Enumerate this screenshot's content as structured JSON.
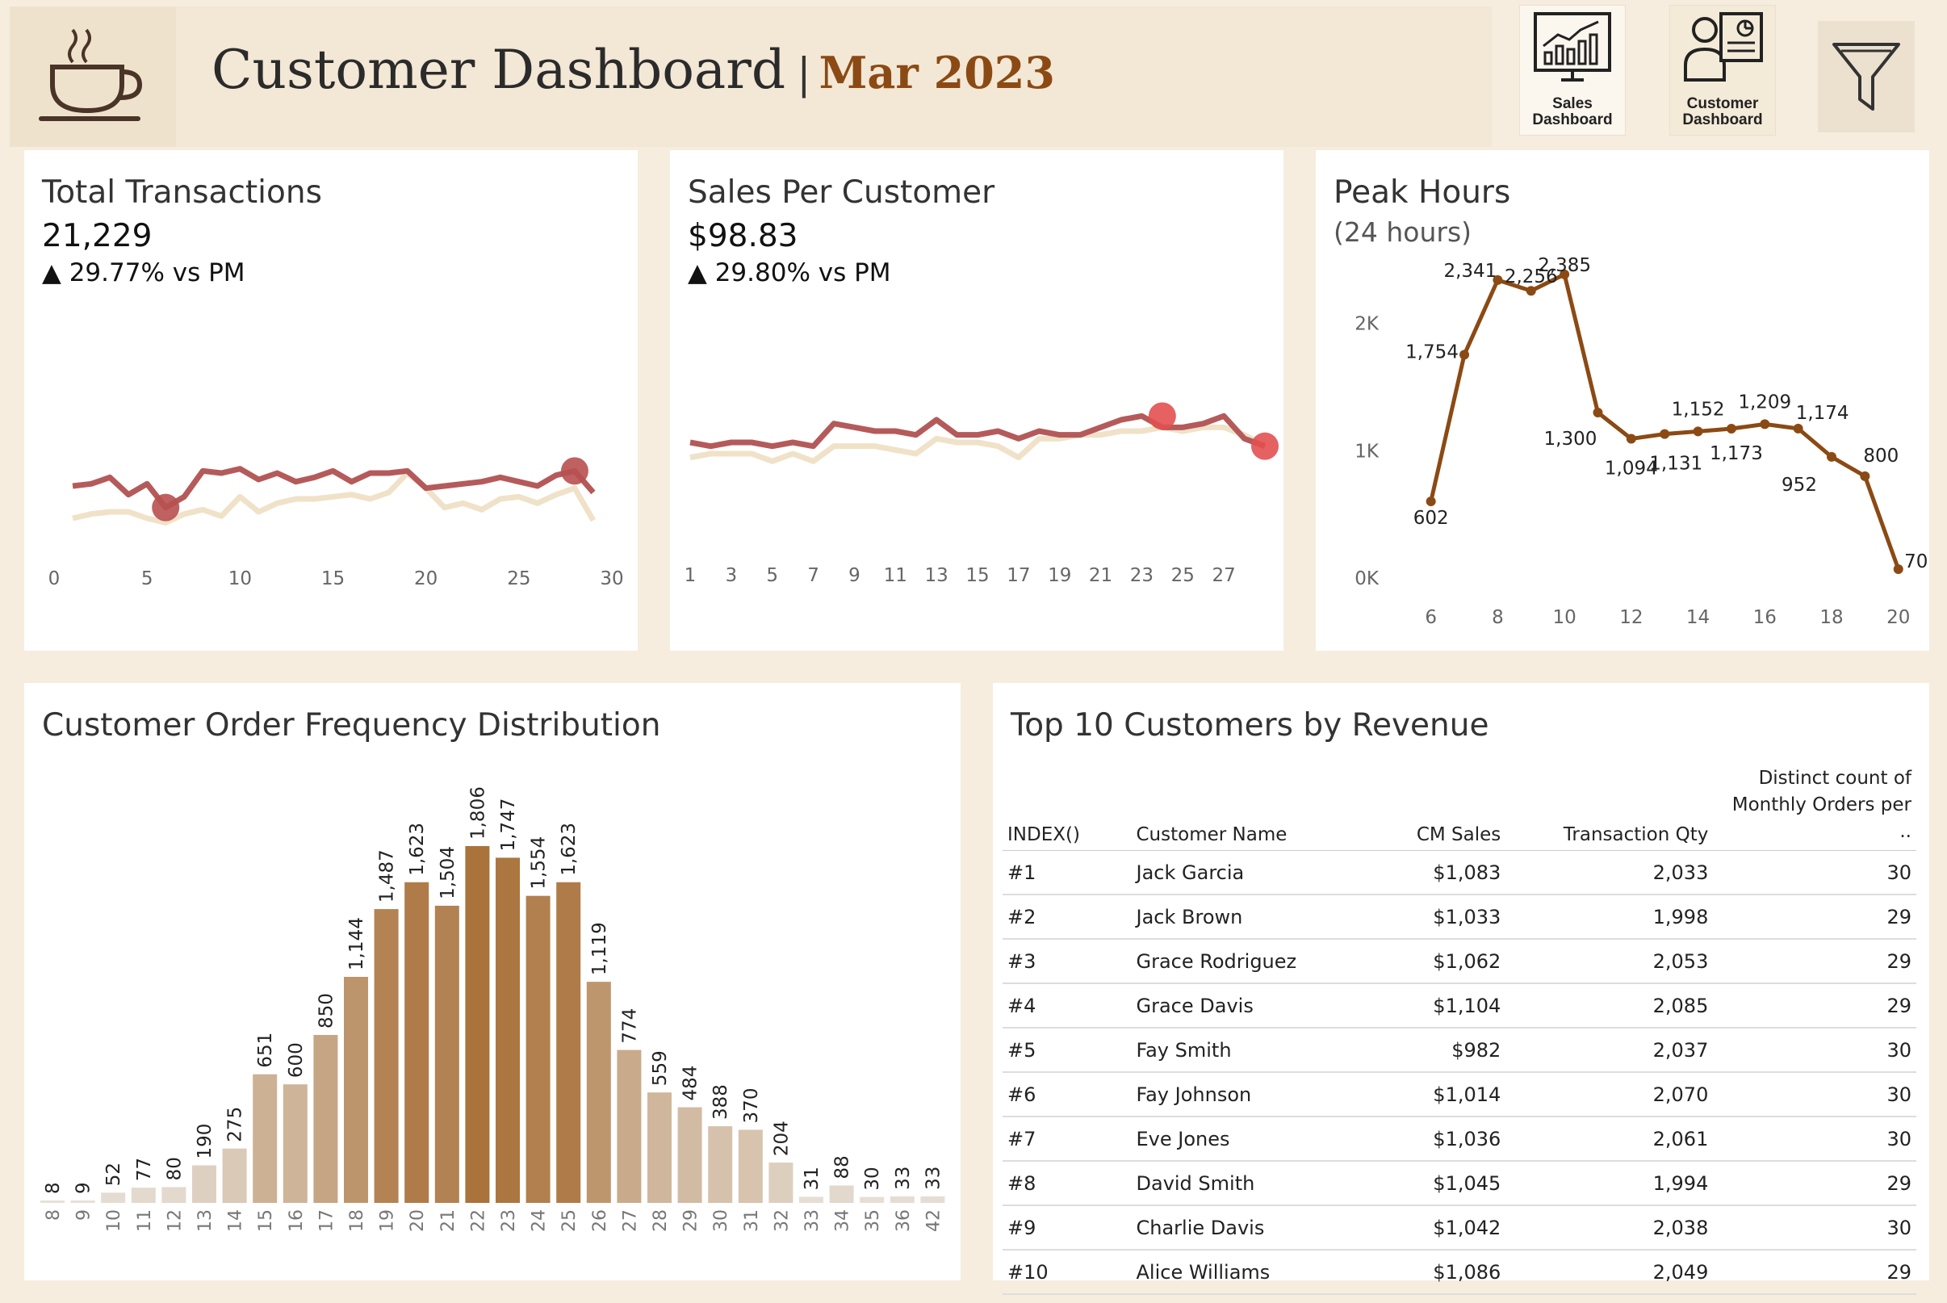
{
  "header": {
    "title": "Customer Dashboard",
    "separator": "|",
    "month": "Mar 2023",
    "nav": [
      {
        "label_line1": "Sales",
        "label_line2": "Dashboard",
        "icon": "sales-chart-icon"
      },
      {
        "label_line1": "Customer",
        "label_line2": "Dashboard",
        "icon": "customer-profile-icon"
      }
    ],
    "filter_icon": "funnel-icon",
    "logo_icon": "coffee-cup-icon"
  },
  "colors": {
    "accent": "#8b4a14",
    "current_line": "#b55a5a",
    "prior_line": "#f0e2c8",
    "peak_line": "#8b4a14",
    "highlight_dot": "#e35050"
  },
  "kpis": {
    "transactions": {
      "title": "Total Transactions",
      "value": "21,229",
      "delta": "▲ 29.77% vs PM"
    },
    "sales_per_customer": {
      "title": "Sales Per Customer",
      "value": "$98.83",
      "delta": "▲ 29.80% vs PM"
    }
  },
  "peak": {
    "title": "Peak Hours",
    "subtitle": "(24 hours)"
  },
  "distribution": {
    "title": "Customer Order Frequency Distribution"
  },
  "top10": {
    "title": "Top 10 Customers by Revenue",
    "columns": {
      "index": "INDEX()",
      "name": "Customer Name",
      "sales": "CM Sales",
      "qty": "Transaction Qty",
      "orders_line1": "Distinct count of",
      "orders_line2": "Monthly Orders per .."
    },
    "rows": [
      {
        "index": "#1",
        "name": "Jack Garcia",
        "sales": "$1,083",
        "qty": "2,033",
        "orders": "30"
      },
      {
        "index": "#2",
        "name": "Jack Brown",
        "sales": "$1,033",
        "qty": "1,998",
        "orders": "29"
      },
      {
        "index": "#3",
        "name": "Grace Rodriguez",
        "sales": "$1,062",
        "qty": "2,053",
        "orders": "29"
      },
      {
        "index": "#4",
        "name": "Grace Davis",
        "sales": "$1,104",
        "qty": "2,085",
        "orders": "29"
      },
      {
        "index": "#5",
        "name": "Fay Smith",
        "sales": "$982",
        "qty": "2,037",
        "orders": "30"
      },
      {
        "index": "#6",
        "name": "Fay Johnson",
        "sales": "$1,014",
        "qty": "2,070",
        "orders": "30"
      },
      {
        "index": "#7",
        "name": "Eve Jones",
        "sales": "$1,036",
        "qty": "2,061",
        "orders": "30"
      },
      {
        "index": "#8",
        "name": "David Smith",
        "sales": "$1,045",
        "qty": "1,994",
        "orders": "29"
      },
      {
        "index": "#9",
        "name": "Charlie Davis",
        "sales": "$1,042",
        "qty": "2,038",
        "orders": "30"
      },
      {
        "index": "#10",
        "name": "Alice Williams",
        "sales": "$1,086",
        "qty": "2,049",
        "orders": "29"
      }
    ]
  },
  "chart_data": [
    {
      "id": "transactions-trend",
      "type": "line",
      "xlabel": "",
      "ylabel": "",
      "xlim": [
        0,
        30
      ],
      "xticks": [
        "0",
        "5",
        "10",
        "15",
        "20",
        "25",
        "30"
      ],
      "ylim": [
        400,
        1000
      ],
      "series": [
        {
          "role": "current",
          "x": [
            1,
            2,
            3,
            4,
            5,
            6,
            7,
            8,
            9,
            10,
            11,
            12,
            13,
            14,
            15,
            16,
            17,
            18,
            19,
            20,
            21,
            22,
            23,
            24,
            25,
            26,
            27,
            28,
            29
          ],
          "values": [
            790,
            800,
            830,
            750,
            800,
            690,
            740,
            860,
            850,
            870,
            820,
            850,
            810,
            830,
            860,
            810,
            850,
            850,
            860,
            780,
            790,
            800,
            810,
            830,
            810,
            790,
            840,
            860,
            760
          ]
        },
        {
          "role": "prior",
          "x": [
            1,
            2,
            3,
            4,
            5,
            6,
            7,
            8,
            9,
            10,
            11,
            12,
            13,
            14,
            15,
            16,
            17,
            18,
            19,
            20,
            21,
            22,
            23,
            24,
            25,
            26,
            27,
            28,
            29
          ],
          "values": [
            640,
            660,
            670,
            670,
            640,
            620,
            660,
            680,
            650,
            740,
            670,
            710,
            730,
            730,
            740,
            750,
            730,
            760,
            850,
            780,
            690,
            710,
            680,
            730,
            740,
            710,
            750,
            780,
            630
          ]
        }
      ],
      "highlights": [
        {
          "x": 6,
          "value": 690,
          "note": "min"
        },
        {
          "x": 28,
          "value": 860,
          "note": "max"
        }
      ]
    },
    {
      "id": "sales-per-customer-trend",
      "type": "line",
      "xlabel": "",
      "ylabel": "",
      "xticks": [
        "1",
        "3",
        "5",
        "7",
        "9",
        "11",
        "13",
        "15",
        "17",
        "19",
        "21",
        "23",
        "25",
        "27"
      ],
      "xlim": [
        1,
        29
      ],
      "ylim": [
        60,
        120
      ],
      "series": [
        {
          "role": "current",
          "x": [
            1,
            2,
            3,
            4,
            5,
            6,
            7,
            8,
            9,
            10,
            11,
            12,
            13,
            14,
            15,
            16,
            17,
            18,
            19,
            20,
            21,
            22,
            23,
            24,
            25,
            26,
            27,
            28,
            29
          ],
          "values": [
            96,
            95,
            96,
            96,
            95,
            96,
            95,
            101,
            100,
            99,
            99,
            98,
            102,
            98,
            98,
            99,
            97,
            99,
            98,
            98,
            100,
            102,
            103,
            100,
            100,
            101,
            103,
            97,
            95
          ]
        },
        {
          "role": "prior",
          "x": [
            1,
            2,
            3,
            4,
            5,
            6,
            7,
            8,
            9,
            10,
            11,
            12,
            13,
            14,
            15,
            16,
            17,
            18,
            19,
            20,
            21,
            22,
            23,
            24,
            25,
            26,
            27,
            28,
            29
          ],
          "values": [
            92,
            93,
            93,
            93,
            91,
            93,
            91,
            95,
            95,
            95,
            94,
            93,
            97,
            96,
            96,
            95,
            92,
            97,
            97,
            98,
            98,
            99,
            99,
            100,
            99,
            100,
            100,
            98,
            95
          ]
        }
      ],
      "highlights": [
        {
          "x": 24,
          "value": 103,
          "note": "max"
        },
        {
          "x": 29,
          "value": 95,
          "note": "min"
        }
      ]
    },
    {
      "id": "peak-hours",
      "type": "line",
      "title": "Peak Hours",
      "subtitle": "(24 hours)",
      "x": [
        6,
        7,
        8,
        9,
        10,
        11,
        12,
        13,
        14,
        15,
        16,
        17,
        18,
        19,
        20
      ],
      "values": [
        602,
        1754,
        2341,
        2256,
        2385,
        1300,
        1094,
        1131,
        1152,
        1173,
        1209,
        1174,
        952,
        800,
        70
      ],
      "labels": [
        "602",
        "1,754",
        "2,341",
        "2,256",
        "2,385",
        "1,300",
        "1,094",
        "1,131",
        "1,152",
        "1,173",
        "1,209",
        "1,174",
        "952",
        "800",
        "70"
      ],
      "xticks": [
        "6",
        "8",
        "10",
        "12",
        "14",
        "16",
        "18",
        "20"
      ],
      "yticks": [
        "0K",
        "1K",
        "2K"
      ],
      "xlim": [
        5.5,
        20.2
      ],
      "ylim": [
        0,
        2600
      ]
    },
    {
      "id": "order-frequency",
      "type": "bar",
      "title": "Customer Order Frequency Distribution",
      "categories": [
        "8",
        "9",
        "10",
        "11",
        "12",
        "13",
        "14",
        "15",
        "16",
        "17",
        "18",
        "19",
        "20",
        "21",
        "22",
        "23",
        "24",
        "25",
        "26",
        "27",
        "28",
        "29",
        "30",
        "31",
        "32",
        "33",
        "34",
        "35",
        "36",
        "42"
      ],
      "values": [
        8,
        9,
        52,
        77,
        80,
        190,
        275,
        651,
        600,
        850,
        1144,
        1487,
        1623,
        1504,
        1806,
        1747,
        1554,
        1623,
        1119,
        774,
        559,
        484,
        388,
        370,
        204,
        31,
        88,
        30,
        33,
        33
      ],
      "labels": [
        "8",
        "9",
        "52",
        "77",
        "80",
        "190",
        "275",
        "651",
        "600",
        "850",
        "1,144",
        "1,487",
        "1,623",
        "1,504",
        "1,806",
        "1,747",
        "1,554",
        "1,623",
        "1,119",
        "774",
        "559",
        "484",
        "388",
        "370",
        "204",
        "31",
        "88",
        "30",
        "33",
        "33"
      ],
      "ylim": [
        0,
        1806
      ]
    }
  ]
}
